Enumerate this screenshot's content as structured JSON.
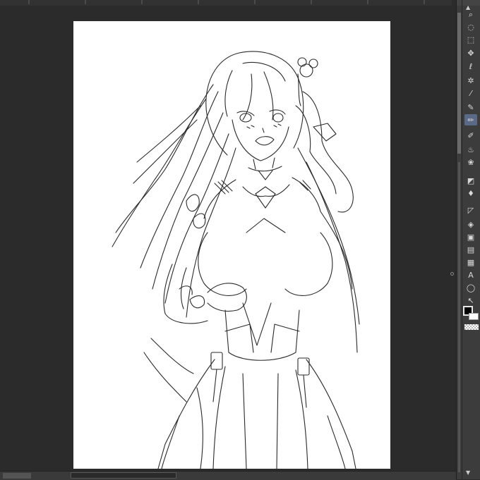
{
  "window": {
    "background": "#2b2b2b",
    "panel_background": "#3c3c3c",
    "accent": "#5a6a86"
  },
  "canvas": {
    "paper_color": "#ffffff",
    "content": "line art of an anime girl with long hair in an ornate dress"
  },
  "tool_panel": {
    "tools": [
      {
        "name": "zoom-icon",
        "glyph": "⌕"
      },
      {
        "name": "marquee-icon",
        "glyph": "◌"
      },
      {
        "name": "object-select-icon",
        "glyph": "⬚"
      },
      {
        "name": "move-icon",
        "glyph": "✥"
      },
      {
        "name": "lasso-icon",
        "glyph": "ℓ"
      },
      {
        "name": "magic-wand-icon",
        "glyph": "✲"
      },
      {
        "name": "eyedropper-icon",
        "glyph": "⁄"
      },
      {
        "name": "pen-icon",
        "glyph": "✎"
      },
      {
        "name": "pencil-icon",
        "glyph": "✏"
      },
      {
        "name": "brush-icon",
        "glyph": "✐"
      },
      {
        "name": "airbrush-icon",
        "glyph": "♨"
      },
      {
        "name": "decoration-icon",
        "glyph": "❀"
      },
      {
        "name": "eraser-icon",
        "glyph": "◩"
      },
      {
        "name": "blend-icon",
        "glyph": "♦"
      },
      {
        "name": "figure-icon",
        "glyph": "◸"
      },
      {
        "name": "fill-icon",
        "glyph": "◈"
      },
      {
        "name": "gradient-icon",
        "glyph": "▣"
      },
      {
        "name": "frame-icon",
        "glyph": "▤"
      },
      {
        "name": "ruler-icon",
        "glyph": "▦"
      },
      {
        "name": "text-icon",
        "glyph": "A"
      },
      {
        "name": "balloon-icon",
        "glyph": "◯"
      },
      {
        "name": "correct-line-icon",
        "glyph": "↖"
      }
    ],
    "colors": {
      "main": "#000000",
      "sub": "#ffffff"
    }
  },
  "status_bar": {}
}
